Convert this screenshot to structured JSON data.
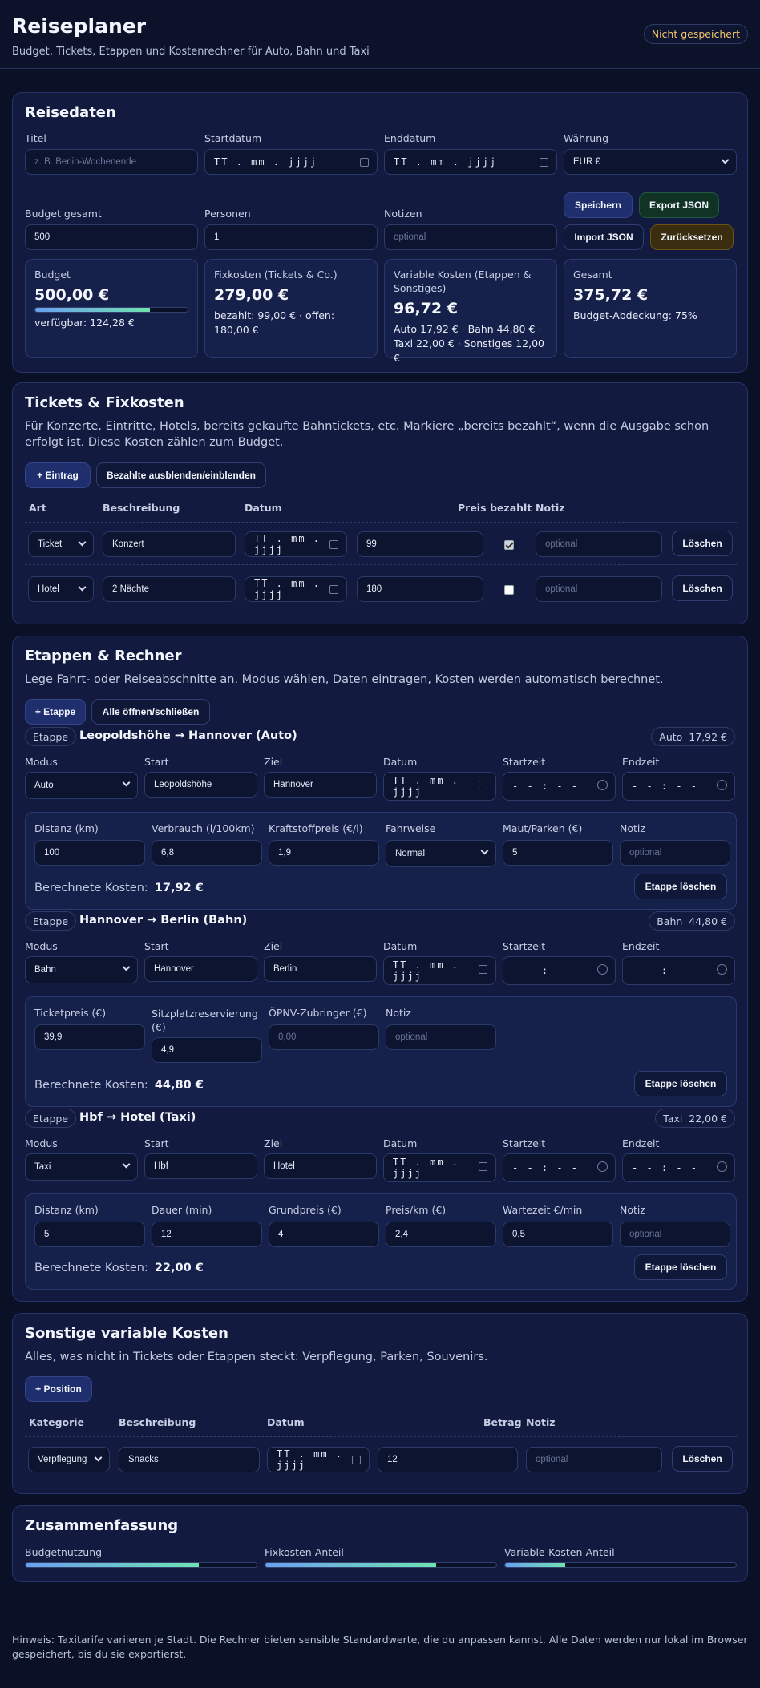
{
  "header": {
    "title": "Reiseplaner",
    "subtitle": "Budget, Tickets, Etappen und Kostenrechner für Auto, Bahn und Taxi",
    "status": "Nicht gespeichert"
  },
  "reisedaten": {
    "heading": "Reisedaten",
    "labels": {
      "titel": "Titel",
      "start": "Startdatum",
      "end": "Enddatum",
      "currency": "Währung",
      "budget": "Budget gesamt",
      "persons": "Personen",
      "notes": "Notizen"
    },
    "titel_placeholder": "z. B. Berlin-Wochenende",
    "date_placeholder": "TT . mm . jjjj",
    "currency_value": "EUR €",
    "budget_value": "500",
    "persons_value": "1",
    "notes_placeholder": "optional",
    "buttons": {
      "save": "Speichern",
      "export": "Export JSON",
      "import": "Import JSON",
      "reset": "Zurücksetzen"
    },
    "stats": {
      "budget": {
        "title": "Budget",
        "value": "500,00 €",
        "sub": "verfügbar: 124,28 €",
        "usage": 0.75
      },
      "fix": {
        "title": "Fixkosten (Tickets & Co.)",
        "value": "279,00 €",
        "sub": "bezahlt: 99,00 € · offen: 180,00 €"
      },
      "var": {
        "title": "Variable Kosten (Etappen & Sonstiges)",
        "value": "96,72 €",
        "sub": "Auto 17,92 € · Bahn 44,80 € · Taxi 22,00 € · Sonstiges 12,00 €"
      },
      "total": {
        "title": "Gesamt",
        "value": "375,72 €",
        "sub": "Budget-Abdeckung: 75%"
      }
    }
  },
  "tickets": {
    "heading": "Tickets & Fixkosten",
    "desc": "Für Konzerte, Eintritte, Hotels, bereits gekaufte Bahntickets, etc. Markiere „bereits bezahlt“, wenn die Ausgabe schon erfolgt ist. Diese Kosten zählen zum Budget.",
    "add": "+ Eintrag",
    "toggle": "Bezahlte ausblenden/einblenden",
    "cols": {
      "art": "Art",
      "desc": "Beschreibung",
      "date": "Datum",
      "price": "Preis",
      "paid": "bezahlt",
      "note": "Notiz"
    },
    "rows": [
      {
        "art": "Ticket",
        "desc": "Konzert",
        "price": "99",
        "paid": true,
        "note": "optional",
        "del": "Löschen"
      },
      {
        "art": "Hotel",
        "desc": "2 Nächte",
        "price": "180",
        "paid": false,
        "note": "optional",
        "del": "Löschen"
      }
    ]
  },
  "etappen": {
    "heading": "Etappen & Rechner",
    "desc": "Lege Fahrt- oder Reiseabschnitte an. Modus wählen, Daten eintragen, Kosten werden automatisch berechnet.",
    "add": "+ Etappe",
    "toggle": "Alle öffnen/schließen",
    "chip": "Etappe",
    "labels": {
      "mode": "Modus",
      "start": "Start",
      "ziel": "Ziel",
      "date": "Datum",
      "starttime": "Startzeit",
      "endtime": "Endzeit"
    },
    "time_placeholder": "- - : - -",
    "calc_label": "Berechnete Kosten:",
    "delete": "Etappe löschen",
    "stages": [
      {
        "title": "Leopoldshöhe → Hannover (Auto)",
        "badge_mode": "Auto",
        "badge_cost": "17,92 €",
        "mode": "Auto",
        "start": "Leopoldshöhe",
        "ziel": "Hannover",
        "fields": [
          {
            "label": "Distanz (km)",
            "value": "100"
          },
          {
            "label": "Verbrauch (l/100km)",
            "value": "6,8"
          },
          {
            "label": "Kraftstoffpreis (€/l)",
            "value": "1,9"
          },
          {
            "label": "Fahrweise",
            "value": "Normal"
          },
          {
            "label": "Maut/Parken (€)",
            "value": "5"
          },
          {
            "label": "Notiz",
            "placeholder": "optional"
          }
        ],
        "cost": "17,92 €"
      },
      {
        "title": "Hannover → Berlin (Bahn)",
        "badge_mode": "Bahn",
        "badge_cost": "44,80 €",
        "mode": "Bahn",
        "start": "Hannover",
        "ziel": "Berlin",
        "fields": [
          {
            "label": "Ticketpreis (€)",
            "value": "39,9"
          },
          {
            "label": "Sitzplatzreservierung (€)",
            "value": "4,9"
          },
          {
            "label": "ÖPNV-Zubringer (€)",
            "placeholder": "0,00"
          },
          {
            "label": "Notiz",
            "placeholder": "optional"
          }
        ],
        "cost": "44,80 €"
      },
      {
        "title": "Hbf → Hotel (Taxi)",
        "badge_mode": "Taxi",
        "badge_cost": "22,00 €",
        "mode": "Taxi",
        "start": "Hbf",
        "ziel": "Hotel",
        "fields": [
          {
            "label": "Distanz (km)",
            "value": "5"
          },
          {
            "label": "Dauer (min)",
            "value": "12"
          },
          {
            "label": "Grundpreis (€)",
            "value": "4"
          },
          {
            "label": "Preis/km (€)",
            "value": "2,4"
          },
          {
            "label": "Wartezeit €/min",
            "value": "0,5"
          },
          {
            "label": "Notiz",
            "placeholder": "optional"
          }
        ],
        "cost": "22,00 €"
      }
    ]
  },
  "sonstige": {
    "heading": "Sonstige variable Kosten",
    "desc": "Alles, was nicht in Tickets oder Etappen steckt: Verpflegung, Parken, Souvenirs.",
    "add": "+ Position",
    "cols": {
      "cat": "Kategorie",
      "desc": "Beschreibung",
      "date": "Datum",
      "amount": "Betrag",
      "note": "Notiz"
    },
    "rows": [
      {
        "cat": "Verpflegung",
        "desc": "Snacks",
        "amount": "12",
        "note": "optional",
        "del": "Löschen"
      }
    ]
  },
  "summary": {
    "heading": "Zusammenfassung",
    "bars": [
      {
        "label": "Budgetnutzung",
        "value": 0.75
      },
      {
        "label": "Fixkosten-Anteil",
        "value": 0.74
      },
      {
        "label": "Variable-Kosten-Anteil",
        "value": 0.26
      }
    ]
  },
  "footer": "Hinweis: Taxitarife variieren je Stadt. Die Rechner bieten sensible Standardwerte, die du anpassen kannst. Alle Daten werden nur lokal im Browser gespeichert, bis du sie exportierst."
}
